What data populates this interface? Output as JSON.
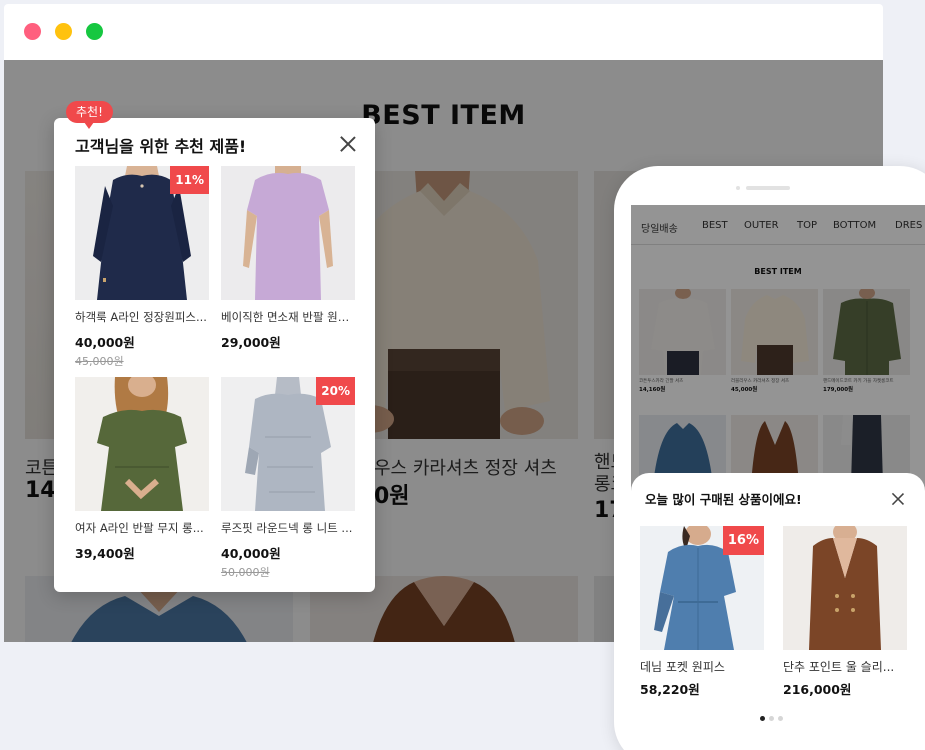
{
  "browser": {
    "controls": [
      "close",
      "minimize",
      "maximize"
    ],
    "colors": {
      "close": "#ff5f7e",
      "minimize": "#ffc20e",
      "maximize": "#16c740"
    }
  },
  "page": {
    "title": "BEST ITEM",
    "background_cards": [
      {
        "name": "코튼",
        "price": "14,"
      },
      {
        "name": "우스 카라셔츠 정장 셔츠",
        "price": "0원"
      },
      {
        "name": "핸드",
        "name2": "롱코",
        "price": "17"
      }
    ]
  },
  "popup": {
    "badge": "추천!",
    "title": "고객님을 위한 추천 제품!",
    "items": [
      {
        "name": "하객룩 A라인 정장원피스...",
        "price": "40,000원",
        "original_price": "45,000원",
        "discount": "11%"
      },
      {
        "name": "베이직한 면소재 반팔 원피스",
        "price": "29,000원",
        "original_price": "",
        "discount": ""
      },
      {
        "name": "여자 A라인 반팔 무지 롱...",
        "price": "39,400원",
        "original_price": "",
        "discount": ""
      },
      {
        "name": "루즈핏 라운드넥 롱 니트 ...",
        "price": "40,000원",
        "original_price": "50,000원",
        "discount": "20%"
      }
    ]
  },
  "mobile": {
    "nav": [
      "당일배송",
      "BEST",
      "OUTER",
      "TOP",
      "BOTTOM",
      "DRES"
    ],
    "best_title": "BEST ITEM",
    "grid": [
      {
        "name": "코튼투스카라 긴팔 셔츠",
        "price": "14,160원"
      },
      {
        "name": "러블리우스 카라셔츠 정장 셔츠",
        "price": "45,000원"
      },
      {
        "name": "핸드메이드코트 카키 가을 자켓롱코트",
        "price": "179,000원"
      }
    ],
    "popup": {
      "title": "오늘 많이 구매된 상품이에요!",
      "items": [
        {
          "name": "데님 포켓 원피스",
          "price": "58,220원",
          "discount": "16%"
        },
        {
          "name": "단추 포인트 울 슬리...",
          "price": "216,000원",
          "discount": ""
        }
      ],
      "page_count": 3,
      "current_page": 1
    }
  }
}
